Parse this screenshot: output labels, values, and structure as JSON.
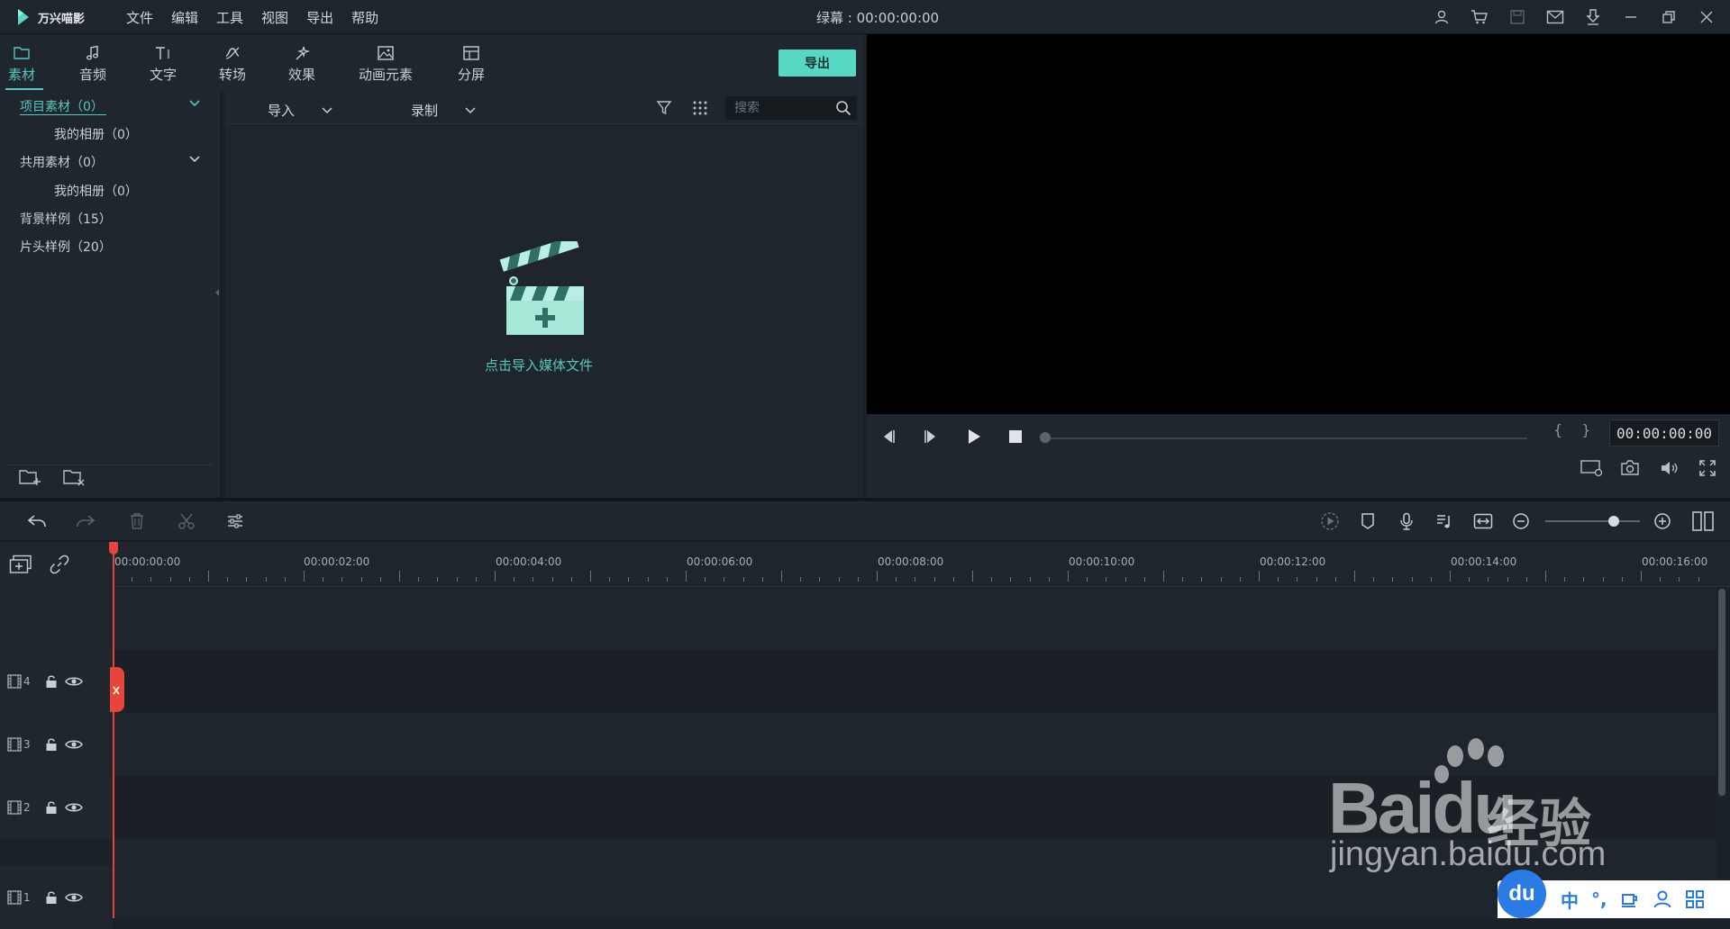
{
  "app": {
    "name": "万兴喵影",
    "title": "绿幕 : 00:00:00:00"
  },
  "menu": [
    "文件",
    "编辑",
    "工具",
    "视图",
    "导出",
    "帮助"
  ],
  "tabs": [
    {
      "label": "素材",
      "icon": "folder-icon"
    },
    {
      "label": "音频",
      "icon": "music-note-icon"
    },
    {
      "label": "文字",
      "icon": "text-icon"
    },
    {
      "label": "转场",
      "icon": "transition-icon"
    },
    {
      "label": "效果",
      "icon": "effects-icon"
    },
    {
      "label": "动画元素",
      "icon": "image-icon"
    },
    {
      "label": "分屏",
      "icon": "split-screen-icon"
    }
  ],
  "export_label": "导出",
  "sidebar": {
    "items": [
      {
        "label": "项目素材（0）"
      },
      {
        "label": "我的相册（0）"
      },
      {
        "label": "共用素材（0）"
      },
      {
        "label": "我的相册（0）"
      },
      {
        "label": "背景样例（15）"
      },
      {
        "label": "片头样例（20）"
      }
    ]
  },
  "media": {
    "import_label": "导入",
    "record_label": "录制",
    "search_placeholder": "搜索",
    "empty_hint": "点击导入媒体文件"
  },
  "preview": {
    "timecode": "00:00:00:00",
    "inout": "{ }"
  },
  "ruler": {
    "labels": [
      "00:00:00:00",
      "00:00:02:00",
      "00:00:04:00",
      "00:00:06:00",
      "00:00:08:00",
      "00:00:10:00",
      "00:00:12:00",
      "00:00:14:00",
      "00:00:16:00"
    ]
  },
  "tracks": [
    {
      "num": "4"
    },
    {
      "num": "3"
    },
    {
      "num": "2"
    },
    {
      "num": "1"
    }
  ],
  "watermark": {
    "brand": "Bai",
    "brand2": "du",
    "cn": "经验",
    "url": "jingyan.baidu.com"
  },
  "ime": {
    "logo": "du",
    "lang": "中",
    "punct": "°,"
  },
  "colors": {
    "accent": "#56c8bd",
    "export_button": "#56d8c4",
    "playhead": "#e5453b"
  }
}
